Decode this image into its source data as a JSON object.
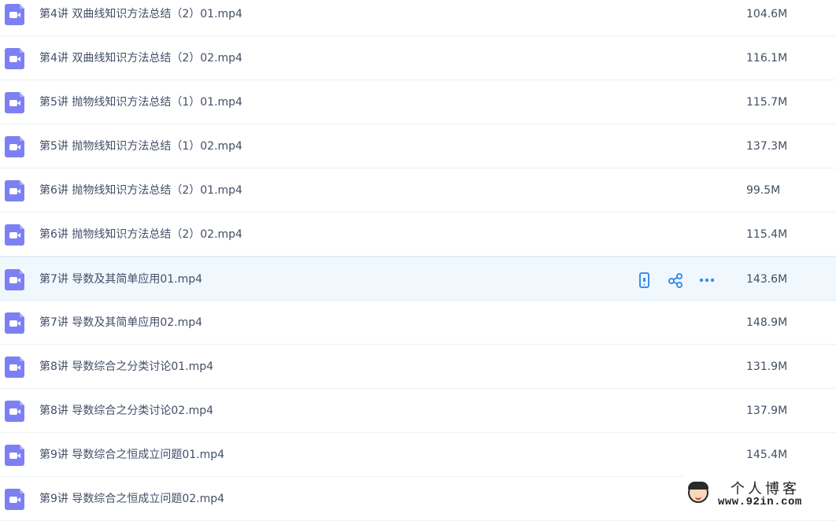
{
  "files": [
    {
      "name": "第4讲 双曲线知识方法总结（2）01.mp4",
      "size": "104.6M"
    },
    {
      "name": "第4讲 双曲线知识方法总结（2）02.mp4",
      "size": "116.1M"
    },
    {
      "name": "第5讲 抛物线知识方法总结（1）01.mp4",
      "size": "115.7M"
    },
    {
      "name": "第5讲 抛物线知识方法总结（1）02.mp4",
      "size": "137.3M"
    },
    {
      "name": "第6讲 抛物线知识方法总结（2）01.mp4",
      "size": "99.5M"
    },
    {
      "name": "第6讲 抛物线知识方法总结（2）02.mp4",
      "size": "115.4M"
    },
    {
      "name": "第7讲 导数及其简单应用01.mp4",
      "size": "143.6M",
      "hovered": true
    },
    {
      "name": "第7讲 导数及其简单应用02.mp4",
      "size": "148.9M"
    },
    {
      "name": "第8讲 导数综合之分类讨论01.mp4",
      "size": "131.9M"
    },
    {
      "name": "第8讲 导数综合之分类讨论02.mp4",
      "size": "137.9M"
    },
    {
      "name": "第9讲 导数综合之恒成立问题01.mp4",
      "size": "145.4M"
    },
    {
      "name": "第9讲 导数综合之恒成立问题02.mp4",
      "size": ""
    }
  ],
  "row_actions": {
    "icons": [
      "phone-icon",
      "share-icon",
      "more-icon"
    ],
    "accent": "#3b8fe3"
  },
  "file_icon_color": "#7d80f3",
  "watermark": {
    "title": "个人博客",
    "url": "www.92in.com"
  }
}
